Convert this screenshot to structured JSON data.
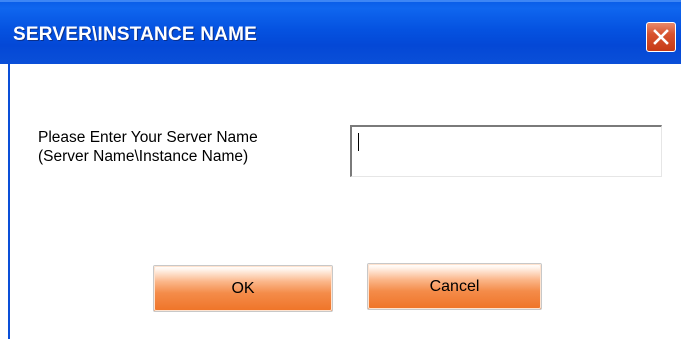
{
  "window": {
    "title": "SERVER\\INSTANCE NAME",
    "close_icon": "close-x-icon"
  },
  "form": {
    "label_line1": "Please Enter Your Server Name",
    "label_line2": "(Server Name\\Instance Name)",
    "server_input_value": "",
    "server_input_placeholder": ""
  },
  "buttons": {
    "ok_label": "OK",
    "cancel_label": "Cancel"
  },
  "colors": {
    "titlebar": "#0552e0",
    "close_button": "#d8532f",
    "button_accent": "#f48c4a"
  }
}
